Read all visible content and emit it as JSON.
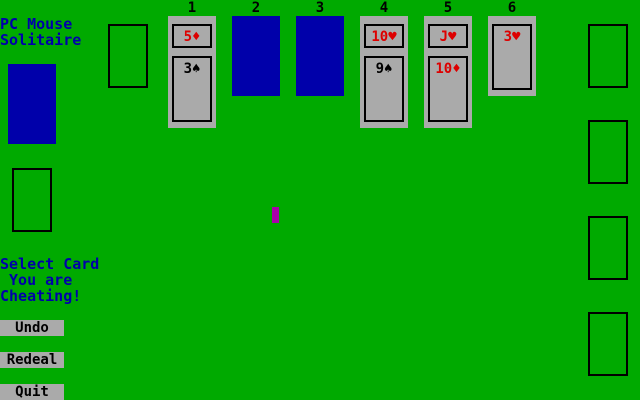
{
  "title_line1": "PC Mouse",
  "title_line2": "Solitaire",
  "status_line1": "Select Card",
  "status_line2": " You are",
  "status_line3": "Cheating!",
  "buttons": {
    "undo": "Undo",
    "redeal": "Redeal",
    "quit": "Quit"
  },
  "columns": [
    {
      "number": "1",
      "cards": [
        "5♦",
        "3♠"
      ]
    },
    {
      "number": "2",
      "cards": []
    },
    {
      "number": "3",
      "cards": []
    },
    {
      "number": "4",
      "cards": [
        "10♥",
        "9♠"
      ]
    },
    {
      "number": "5",
      "cards": [
        "J♥",
        "10♦"
      ]
    },
    {
      "number": "6",
      "cards": [
        "3♥"
      ]
    }
  ],
  "colors": {
    "felt": "#00aa00",
    "card_back": "#0000aa",
    "card_face": "#aaaaaa",
    "red_suit": "#dd0000",
    "cursor": "#aa00aa",
    "text": "#0000aa"
  }
}
